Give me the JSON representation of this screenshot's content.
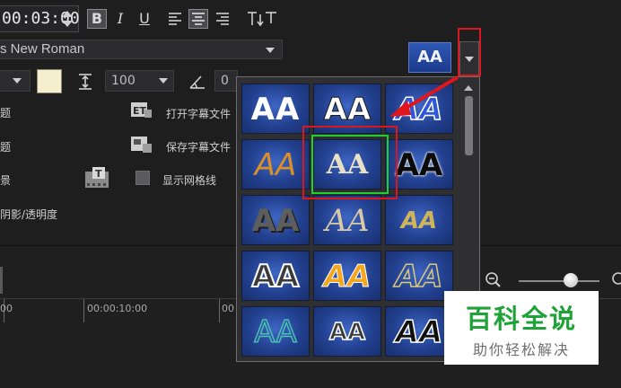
{
  "toolbar": {
    "timecode": "00:03:00",
    "bold_label": "B",
    "italic_label": "I",
    "underline_label": "U"
  },
  "font": {
    "family_value": "s New Roman",
    "size_value": "100",
    "angle_value": "0"
  },
  "title_style": {
    "preview_text": "AA"
  },
  "options": {
    "open_subtitle": "打开字幕文件",
    "save_subtitle": "保存字幕文件",
    "show_grid": "显示网格线",
    "shadow_opacity": "阴影/透明度",
    "row1_fragment": "题",
    "row2_fragment": "题",
    "row3_fragment": "景"
  },
  "timeline": {
    "tick_labels": [
      "00",
      "00:00:10:00",
      "00"
    ]
  },
  "gallery": {
    "styles": [
      {
        "text": "AA",
        "style": "white-bold"
      },
      {
        "text": "AA",
        "style": "white-outline-dark"
      },
      {
        "text": "AA",
        "style": "blue-italic-outline"
      },
      {
        "text": "AA",
        "style": "orange-italic"
      },
      {
        "text": "AA",
        "style": "cream-serif-selected"
      },
      {
        "text": "AA",
        "style": "black-white-glow"
      },
      {
        "text": "AA",
        "style": "grey-shadow"
      },
      {
        "text": "AA",
        "style": "beige-serif-italic"
      },
      {
        "text": "AA",
        "style": "gold-condensed-italic"
      },
      {
        "text": "AA",
        "style": "white-outline-round"
      },
      {
        "text": "AA",
        "style": "yellow-orange-italic"
      },
      {
        "text": "AA",
        "style": "gold-outline-italic"
      },
      {
        "text": "AA",
        "style": "teal-outline"
      },
      {
        "text": "AA",
        "style": "white-condensed-outline"
      },
      {
        "text": "AA",
        "style": "black-white-outline-italic"
      }
    ]
  },
  "watermark": {
    "title": "百科全说",
    "subtitle": "助你轻松解决"
  },
  "colors": {
    "highlight_red": "#d8181e",
    "selection_green": "#1fd12b",
    "text_color_swatch": "#f6efcd",
    "watermark_green": "#1fa338"
  }
}
